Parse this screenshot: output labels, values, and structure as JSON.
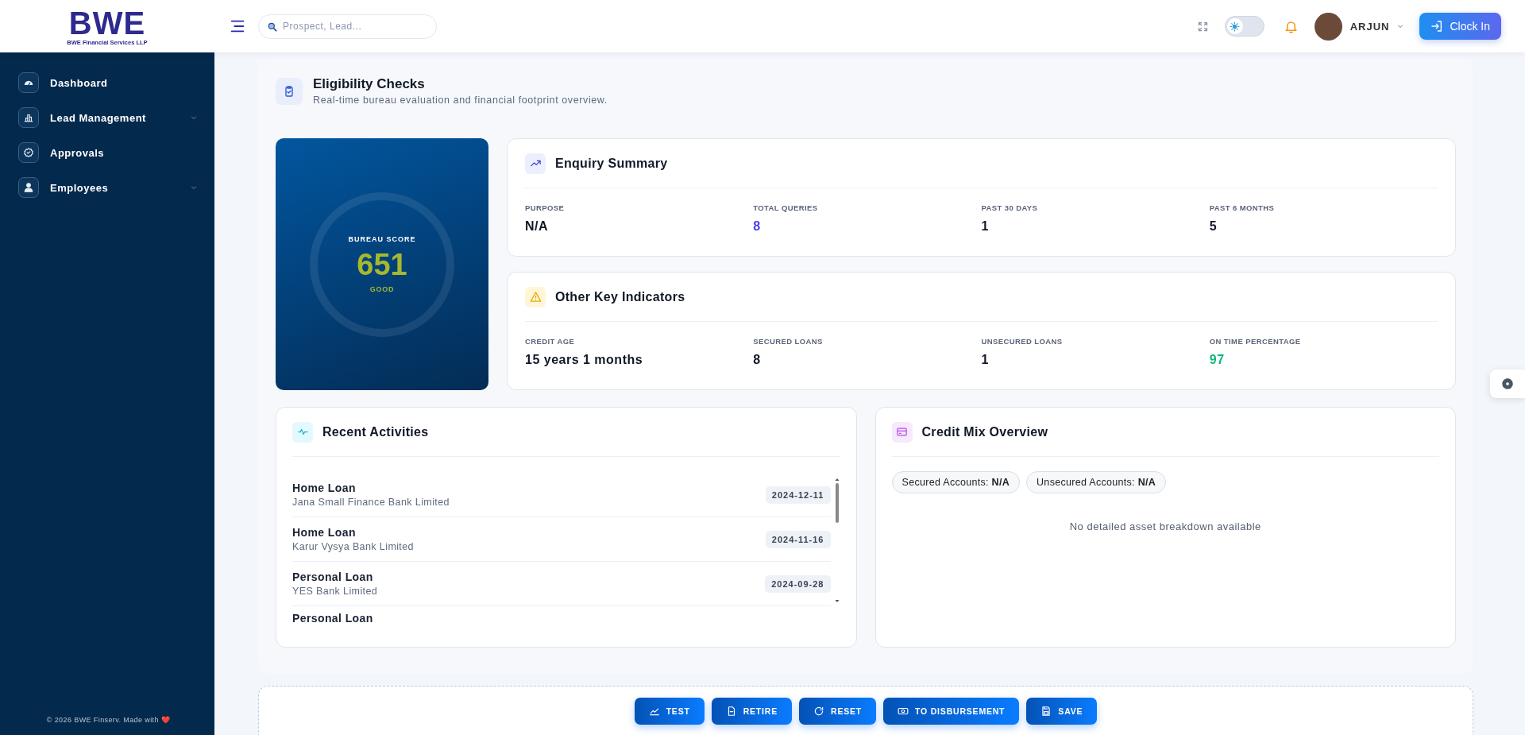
{
  "header": {
    "logo_text": "BWE",
    "logo_subtitle": "BWE Financial Services LLP",
    "search": {
      "placeholder": "Prospect, Lead..."
    },
    "theme_toggle": {
      "on": false
    },
    "user": {
      "name": "ARJUN"
    },
    "clock_in_button": "Clock In"
  },
  "sidebar": {
    "items": [
      {
        "label": "Dashboard",
        "has_submenu": false
      },
      {
        "label": "Lead Management",
        "has_submenu": true
      },
      {
        "label": "Approvals",
        "has_submenu": false
      },
      {
        "label": "Employees",
        "has_submenu": true
      }
    ],
    "footer": "© 2026 BWE Finserv. Made with ❤️"
  },
  "page": {
    "title": "Eligibility Checks",
    "subtitle": "Real-time bureau evaluation and financial footprint overview."
  },
  "bureau_score": {
    "label": "BUREAU SCORE",
    "score": "651",
    "rating": "GOOD"
  },
  "enquiry_summary": {
    "title": "Enquiry Summary",
    "metrics": [
      {
        "label": "PURPOSE",
        "value": "N/A",
        "kind": "plain"
      },
      {
        "label": "TOTAL QUERIES",
        "value": "8",
        "kind": "accent"
      },
      {
        "label": "PAST 30 DAYS",
        "value": "1",
        "kind": "plain"
      },
      {
        "label": "PAST 6 MONTHS",
        "value": "5",
        "kind": "plain"
      }
    ]
  },
  "other_indicators": {
    "title": "Other Key Indicators",
    "metrics": [
      {
        "label": "CREDIT AGE",
        "value": "15 years 1 months",
        "kind": "plain"
      },
      {
        "label": "SECURED LOANS",
        "value": "8",
        "kind": "plain"
      },
      {
        "label": "UNSECURED LOANS",
        "value": "1",
        "kind": "plain"
      },
      {
        "label": "ON TIME PERCENTAGE",
        "value": "97",
        "kind": "good"
      }
    ]
  },
  "recent_activities": {
    "title": "Recent Activities",
    "items": [
      {
        "title": "Home Loan",
        "lender": "Jana Small Finance Bank Limited",
        "date": "2024-12-11"
      },
      {
        "title": "Home Loan",
        "lender": "Karur Vysya Bank Limited",
        "date": "2024-11-16"
      },
      {
        "title": "Personal Loan",
        "lender": "YES Bank Limited",
        "date": "2024-09-28"
      },
      {
        "title": "Personal Loan"
      }
    ]
  },
  "credit_mix": {
    "title": "Credit Mix Overview",
    "pills": [
      "Secured Accounts: **N/A**",
      "Unsecured Accounts: **N/A**"
    ],
    "empty_message": "No detailed asset breakdown available"
  },
  "actions": [
    {
      "label": "TEST"
    },
    {
      "label": "RETIRE"
    },
    {
      "label": "RESET"
    },
    {
      "label": "TO DISBURSEMENT"
    },
    {
      "label": "SAVE"
    }
  ]
}
